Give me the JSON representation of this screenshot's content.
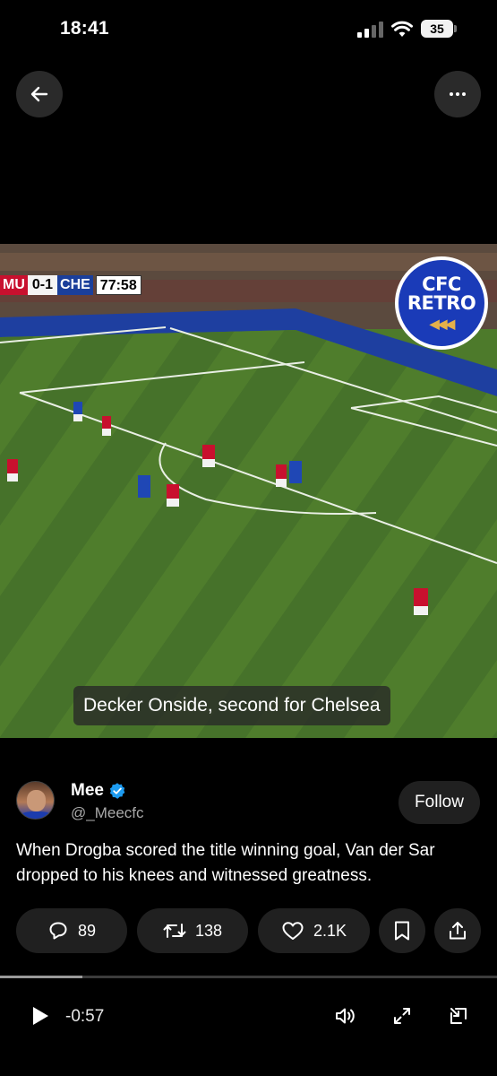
{
  "status_bar": {
    "time": "18:41",
    "battery": "35",
    "icons": [
      "cellular-signal-icon",
      "wifi-icon",
      "battery-icon"
    ]
  },
  "nav": {
    "back_icon": "arrow-left-icon",
    "more_icon": "more-horizontal-icon"
  },
  "video": {
    "scoreboard": {
      "home": "MU",
      "score": "0-1",
      "away": "CHE",
      "clock": "77:58"
    },
    "watermark": {
      "line1": "CFC",
      "line2": "RETRO"
    },
    "caption": "Decker Onside, second for Chelsea",
    "colors": {
      "pitch": "#4d7a2b",
      "home_team": "#c8102e",
      "away_team": "#1b3f9b"
    }
  },
  "post": {
    "author": {
      "name": "Mee",
      "handle": "@_Meecfc",
      "verified": true
    },
    "follow_label": "Follow",
    "text": "When Drogba scored the title winning goal, Van der Sar dropped to his knees and witnessed greatness.",
    "actions": {
      "replies": "89",
      "reposts": "138",
      "likes": "2.1K"
    },
    "accent_color": "#1d9bf0"
  },
  "player": {
    "progress": 0.165,
    "time_remaining": "-0:57"
  }
}
